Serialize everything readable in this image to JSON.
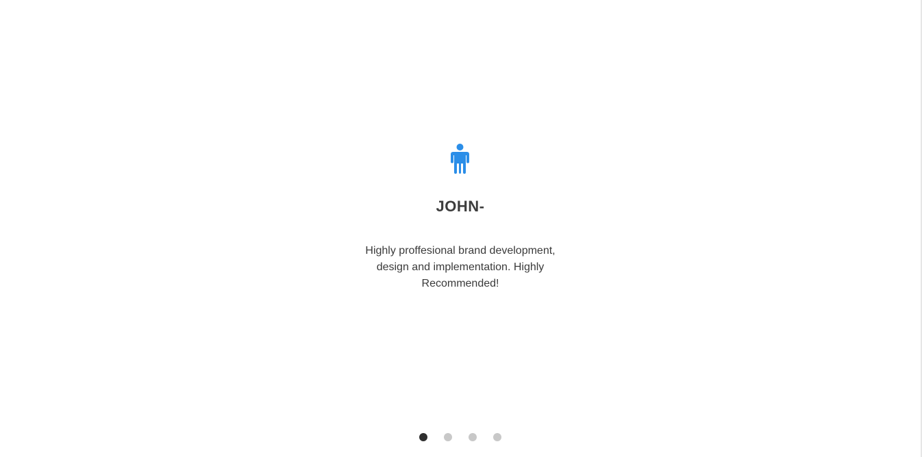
{
  "testimonial": {
    "icon": "person-icon",
    "name": "JOHN-",
    "quote": "Highly proffesional brand development, design and implementation. Highly Recommended!"
  },
  "carousel": {
    "total_slides": 4,
    "active_index": 0
  },
  "colors": {
    "icon": "#2b8ee8",
    "name": "#3d3d3d",
    "text": "#3a3a3a",
    "dot_active": "#2f2f2f",
    "dot_inactive": "#c8c8c8"
  }
}
